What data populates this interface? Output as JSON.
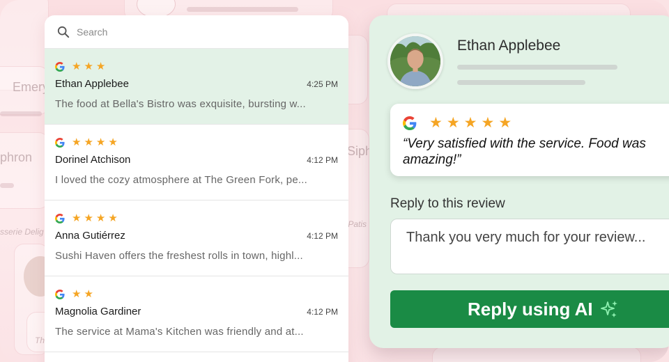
{
  "search": {
    "placeholder": "Search"
  },
  "reviews": [
    {
      "stars": 3,
      "name": "Ethan Applebee",
      "time": "4:25 PM",
      "snippet": "The food at Bella's Bistro was exquisite, bursting w..."
    },
    {
      "stars": 4,
      "name": "Dorinel Atchison",
      "time": "4:12 PM",
      "snippet": "I loved the cozy atmosphere at The Green Fork, pe..."
    },
    {
      "stars": 4,
      "name": "Anna Gutiérrez",
      "time": "4:12 PM",
      "snippet": "Sushi Haven offers the freshest rolls in town, highl..."
    },
    {
      "stars": 2,
      "name": "Magnolia Gardiner",
      "time": "4:12 PM",
      "snippet": "The service at Mama's Kitchen was friendly and at..."
    }
  ],
  "detail": {
    "name": "Ethan Applebee",
    "stars": 5,
    "quote": "“Very satisfied with the service. Food was amazing!”",
    "reply_label": "Reply to this review",
    "reply_text": "Thank you very much for your review...",
    "ai_button_label": "Reply using AI"
  },
  "background": {
    "ghost_name_1": "Emery",
    "ghost_name_2": "phron",
    "ghost_name_3": "Siph",
    "ghost_place_1": "sserie Delig",
    "ghost_place_2": "c Patis",
    "ghost_place_3": "Th"
  },
  "colors": {
    "accent_green": "#1a8b45",
    "star": "#f5a524",
    "selected_row": "#e3f2e7",
    "panel": "#e2f2e6"
  }
}
